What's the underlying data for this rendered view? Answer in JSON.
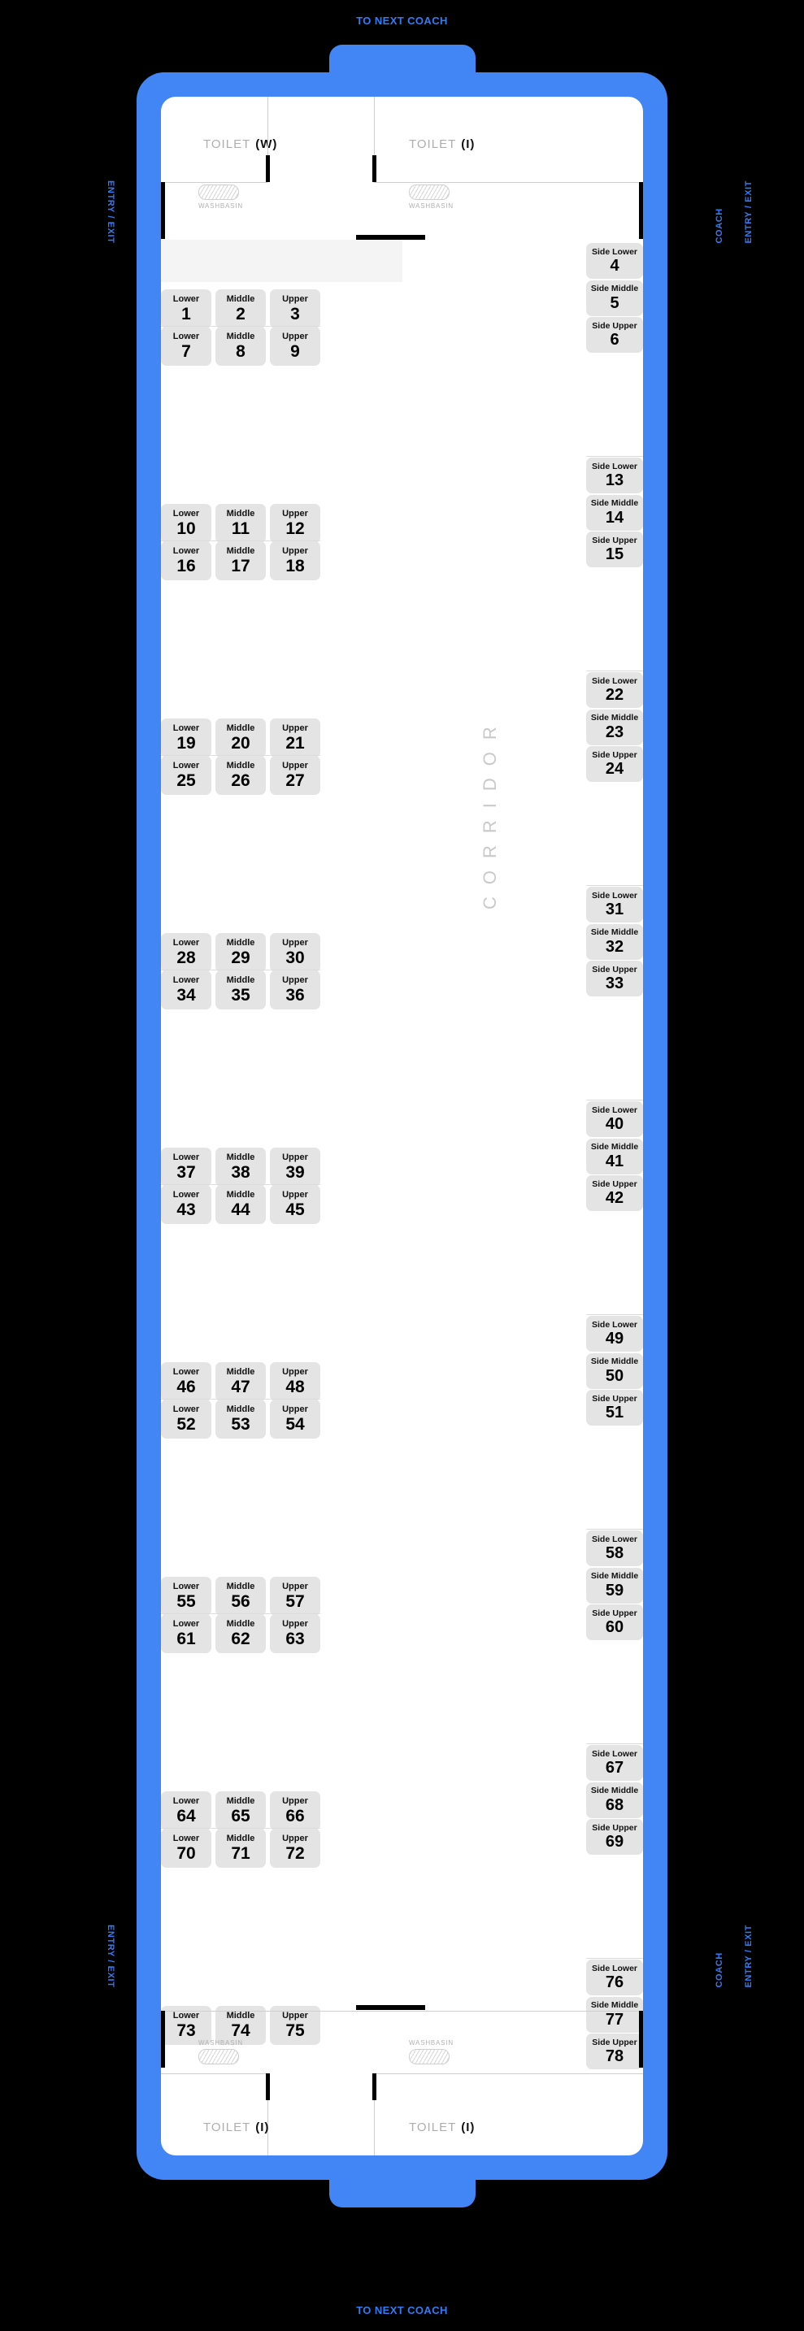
{
  "coach": {
    "to_next_coach_top": "TO NEXT COACH",
    "to_next_coach_bottom": "TO NEXT COACH",
    "entry_exit_top_left": "COACH\nENTRY / EXIT",
    "entry_exit_top_right": "COACH\nENTRY / EXIT",
    "entry_exit_bottom_left": "COACH\nENTRY / EXIT",
    "entry_exit_bottom_right": "COACH\nENTRY / EXIT",
    "corridor_label": "CORRIDOR",
    "colors": {
      "shell": "#4285F4",
      "floor": "#ffffff",
      "seat": "#e4e4e4",
      "label_blue": "#2f7df6",
      "muted": "#aeaeae"
    }
  },
  "facilities": {
    "toilet_top_left": {
      "name": "TOILET",
      "type": "(W)"
    },
    "toilet_top_right": {
      "name": "TOILET",
      "type": "(I)"
    },
    "toilet_bottom_left": {
      "name": "TOILET",
      "type": "(I)"
    },
    "toilet_bottom_right": {
      "name": "TOILET",
      "type": "(I)"
    },
    "washbasin_label": "WASHBASIN",
    "washbasins": 4
  },
  "berth_types": {
    "lower": "Lower",
    "middle": "Middle",
    "upper": "Upper",
    "side_lower": "Side Lower",
    "side_middle": "Side Middle",
    "side_upper": "Side Upper"
  },
  "main_bays": [
    {
      "rows": [
        [
          {
            "berth": "Lower",
            "num": "1"
          },
          {
            "berth": "Middle",
            "num": "2"
          },
          {
            "berth": "Upper",
            "num": "3"
          }
        ],
        [
          {
            "berth": "Lower",
            "num": "7"
          },
          {
            "berth": "Middle",
            "num": "8"
          },
          {
            "berth": "Upper",
            "num": "9"
          }
        ]
      ]
    },
    {
      "rows": [
        [
          {
            "berth": "Lower",
            "num": "10"
          },
          {
            "berth": "Middle",
            "num": "11"
          },
          {
            "berth": "Upper",
            "num": "12"
          }
        ],
        [
          {
            "berth": "Lower",
            "num": "16"
          },
          {
            "berth": "Middle",
            "num": "17"
          },
          {
            "berth": "Upper",
            "num": "18"
          }
        ]
      ]
    },
    {
      "rows": [
        [
          {
            "berth": "Lower",
            "num": "19"
          },
          {
            "berth": "Middle",
            "num": "20"
          },
          {
            "berth": "Upper",
            "num": "21"
          }
        ],
        [
          {
            "berth": "Lower",
            "num": "25"
          },
          {
            "berth": "Middle",
            "num": "26"
          },
          {
            "berth": "Upper",
            "num": "27"
          }
        ]
      ]
    },
    {
      "rows": [
        [
          {
            "berth": "Lower",
            "num": "28"
          },
          {
            "berth": "Middle",
            "num": "29"
          },
          {
            "berth": "Upper",
            "num": "30"
          }
        ],
        [
          {
            "berth": "Lower",
            "num": "34"
          },
          {
            "berth": "Middle",
            "num": "35"
          },
          {
            "berth": "Upper",
            "num": "36"
          }
        ]
      ]
    },
    {
      "rows": [
        [
          {
            "berth": "Lower",
            "num": "37"
          },
          {
            "berth": "Middle",
            "num": "38"
          },
          {
            "berth": "Upper",
            "num": "39"
          }
        ],
        [
          {
            "berth": "Lower",
            "num": "43"
          },
          {
            "berth": "Middle",
            "num": "44"
          },
          {
            "berth": "Upper",
            "num": "45"
          }
        ]
      ]
    },
    {
      "rows": [
        [
          {
            "berth": "Lower",
            "num": "46"
          },
          {
            "berth": "Middle",
            "num": "47"
          },
          {
            "berth": "Upper",
            "num": "48"
          }
        ],
        [
          {
            "berth": "Lower",
            "num": "52"
          },
          {
            "berth": "Middle",
            "num": "53"
          },
          {
            "berth": "Upper",
            "num": "54"
          }
        ]
      ]
    },
    {
      "rows": [
        [
          {
            "berth": "Lower",
            "num": "55"
          },
          {
            "berth": "Middle",
            "num": "56"
          },
          {
            "berth": "Upper",
            "num": "57"
          }
        ],
        [
          {
            "berth": "Lower",
            "num": "61"
          },
          {
            "berth": "Middle",
            "num": "62"
          },
          {
            "berth": "Upper",
            "num": "63"
          }
        ]
      ]
    },
    {
      "rows": [
        [
          {
            "berth": "Lower",
            "num": "64"
          },
          {
            "berth": "Middle",
            "num": "65"
          },
          {
            "berth": "Upper",
            "num": "66"
          }
        ],
        [
          {
            "berth": "Lower",
            "num": "70"
          },
          {
            "berth": "Middle",
            "num": "71"
          },
          {
            "berth": "Upper",
            "num": "72"
          }
        ]
      ]
    },
    {
      "rows": [
        [
          {
            "berth": "Lower",
            "num": "73"
          },
          {
            "berth": "Middle",
            "num": "74"
          },
          {
            "berth": "Upper",
            "num": "75"
          }
        ]
      ]
    }
  ],
  "side_bays": [
    {
      "seats": [
        {
          "berth": "Side Lower",
          "num": "4"
        },
        {
          "berth": "Side Middle",
          "num": "5"
        },
        {
          "berth": "Side Upper",
          "num": "6"
        }
      ]
    },
    {
      "seats": [
        {
          "berth": "Side Lower",
          "num": "13"
        },
        {
          "berth": "Side Middle",
          "num": "14"
        },
        {
          "berth": "Side Upper",
          "num": "15"
        }
      ]
    },
    {
      "seats": [
        {
          "berth": "Side Lower",
          "num": "22"
        },
        {
          "berth": "Side Middle",
          "num": "23"
        },
        {
          "berth": "Side Upper",
          "num": "24"
        }
      ]
    },
    {
      "seats": [
        {
          "berth": "Side Lower",
          "num": "31"
        },
        {
          "berth": "Side Middle",
          "num": "32"
        },
        {
          "berth": "Side Upper",
          "num": "33"
        }
      ]
    },
    {
      "seats": [
        {
          "berth": "Side Lower",
          "num": "40"
        },
        {
          "berth": "Side Middle",
          "num": "41"
        },
        {
          "berth": "Side Upper",
          "num": "42"
        }
      ]
    },
    {
      "seats": [
        {
          "berth": "Side Lower",
          "num": "49"
        },
        {
          "berth": "Side Middle",
          "num": "50"
        },
        {
          "berth": "Side Upper",
          "num": "51"
        }
      ]
    },
    {
      "seats": [
        {
          "berth": "Side Lower",
          "num": "58"
        },
        {
          "berth": "Side Middle",
          "num": "59"
        },
        {
          "berth": "Side Upper",
          "num": "60"
        }
      ]
    },
    {
      "seats": [
        {
          "berth": "Side Lower",
          "num": "67"
        },
        {
          "berth": "Side Middle",
          "num": "68"
        },
        {
          "berth": "Side Upper",
          "num": "69"
        }
      ]
    },
    {
      "seats": [
        {
          "berth": "Side Lower",
          "num": "76"
        },
        {
          "berth": "Side Middle",
          "num": "77"
        },
        {
          "berth": "Side Upper",
          "num": "78"
        }
      ]
    }
  ]
}
